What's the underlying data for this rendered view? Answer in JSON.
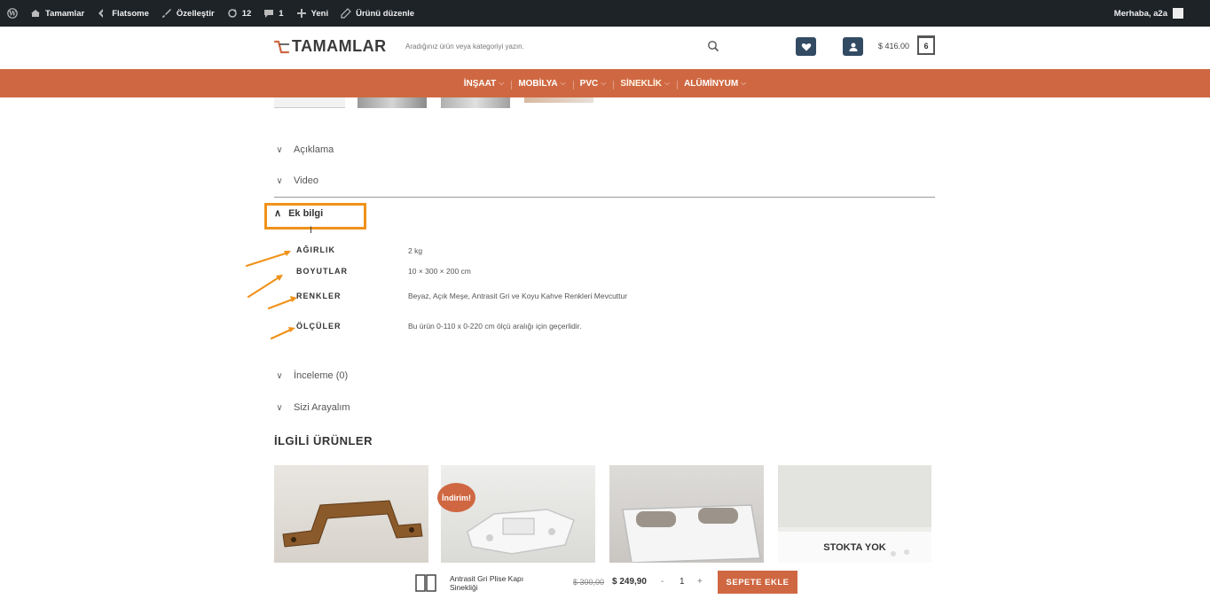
{
  "adminbar": {
    "site": "Tamamlar",
    "theme": "Flatsome",
    "customize": "Özelleştir",
    "updates": "12",
    "comments": "1",
    "new": "Yeni",
    "edit_product": "Ürünü düzenle",
    "greeting": "Merhaba, a2a"
  },
  "header": {
    "logo": "TAMAMLAR",
    "search_placeholder": "Aradığınız ürün veya kategoriyi yazın.",
    "cart_total": "$ 416.00",
    "cart_count": "6"
  },
  "nav": {
    "items": [
      {
        "label": "İNŞAAT"
      },
      {
        "label": "MOBİLYA"
      },
      {
        "label": "PVC"
      },
      {
        "label": "SİNEKLİK"
      },
      {
        "label": "ALÜMİNYUM"
      }
    ]
  },
  "tabs": {
    "aciklama": "Açıklama",
    "video": "Video",
    "ek_bilgi": "Ek bilgi",
    "inceleme": "İnceleme (0)",
    "sizi_arayalim": "Sizi Arayalım"
  },
  "attributes": [
    {
      "label": "AĞIRLIK",
      "value": "2 kg"
    },
    {
      "label": "BOYUTLAR",
      "value": "10 × 300 × 200 cm"
    },
    {
      "label": "RENKLER",
      "value": "Beyaz, Açık Meşe, Antrasit Gri ve Koyu Kahve Renkleri Mevcuttur"
    },
    {
      "label": "ÖLÇÜLER",
      "value": "Bu ürün 0-110 x 0-220 cm ölçü aralığı için geçerlidir."
    }
  ],
  "related": {
    "title": "İLGİLİ ÜRÜNLER",
    "sale_badge": "İndirim!",
    "out_of_stock": "STOKTA YOK"
  },
  "sticky": {
    "product_name": "Antrasit Gri Plise Kapı Sinekliği",
    "old_price": "$ 300,00",
    "new_price": "$ 249,90",
    "minus": "-",
    "qty": "1",
    "plus": "+",
    "add_to_cart": "SEPETE EKLE"
  },
  "colors": {
    "accent": "#cf6842",
    "highlight": "#f0921a",
    "header_btn": "#334a63",
    "adminbar": "#1d2327"
  }
}
